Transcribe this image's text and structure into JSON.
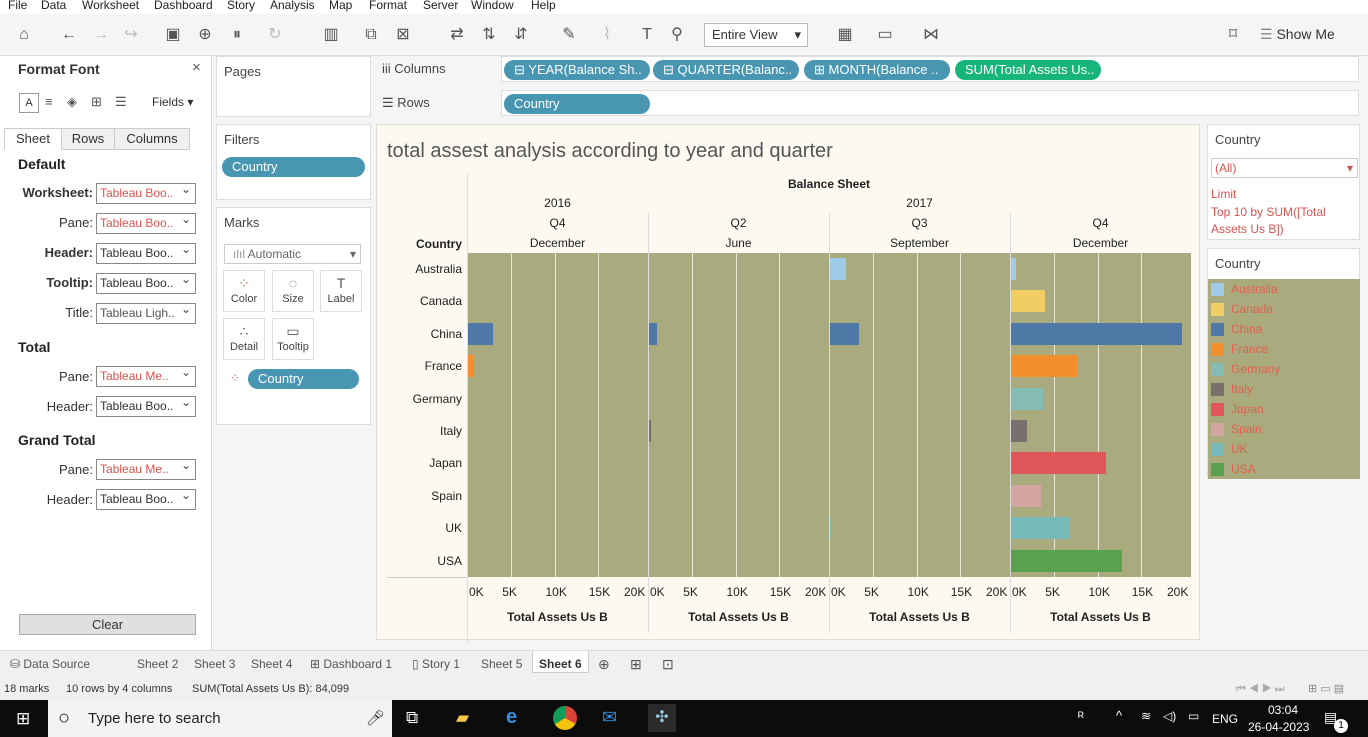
{
  "menu": [
    "File",
    "Data",
    "Worksheet",
    "Dashboard",
    "Story",
    "Analysis",
    "Map",
    "Format",
    "Server",
    "Window",
    "Help"
  ],
  "toolbar": {
    "view_select": "Entire View",
    "show_me": "Show Me"
  },
  "format_panel": {
    "title": "Format Font",
    "fields_label": "Fields",
    "tabs": [
      "Sheet",
      "Rows",
      "Columns"
    ],
    "sections": {
      "default": {
        "title": "Default",
        "worksheet_label": "Worksheet:",
        "worksheet_value": "Tableau Boo..",
        "pane_label": "Pane:",
        "pane_value": "Tableau Boo..",
        "header_label": "Header:",
        "header_value": "Tableau Boo..",
        "tooltip_label": "Tooltip:",
        "tooltip_value": "Tableau Boo..",
        "title_label": "Title:",
        "title_value": "Tableau Ligh.."
      },
      "total": {
        "title": "Total",
        "pane_label": "Pane:",
        "pane_value": "Tableau Me..",
        "header_label": "Header:",
        "header_value": "Tableau Boo.."
      },
      "grand_total": {
        "title": "Grand Total",
        "pane_label": "Pane:",
        "pane_value": "Tableau Me..",
        "header_label": "Header:",
        "header_value": "Tableau Boo.."
      }
    },
    "clear_label": "Clear"
  },
  "pages": {
    "title": "Pages"
  },
  "filters": {
    "title": "Filters",
    "pill": "Country"
  },
  "marks": {
    "title": "Marks",
    "type": "Automatic",
    "buttons": [
      "Color",
      "Size",
      "Label",
      "Detail",
      "Tooltip"
    ],
    "pill": "Country"
  },
  "shelves": {
    "columns_label": "Columns",
    "rows_label": "Rows",
    "columns": [
      "YEAR(Balance Sh..",
      "QUARTER(Balanc..",
      "MONTH(Balance ..",
      "SUM(Total Assets Us.."
    ],
    "rows": [
      "Country"
    ]
  },
  "view": {
    "title": "total assest analysis according to year and quarter",
    "header_top": "Balance Sheet",
    "row_header": "Country",
    "years": [
      "2016",
      "2017"
    ],
    "panes": [
      {
        "quarter": "Q4",
        "month": "December"
      },
      {
        "quarter": "Q2",
        "month": "June"
      },
      {
        "quarter": "Q3",
        "month": "September"
      },
      {
        "quarter": "Q4",
        "month": "December"
      }
    ],
    "ticks": [
      "0K",
      "5K",
      "10K",
      "15K",
      "20K"
    ],
    "axis_title": "Total Assets Us B"
  },
  "chart_data": {
    "type": "bar",
    "title": "total assest analysis according to year and quarter",
    "categories": [
      "Australia",
      "Canada",
      "China",
      "France",
      "Germany",
      "Italy",
      "Japan",
      "Spain",
      "UK",
      "USA"
    ],
    "xlabel": "Total Assets Us B",
    "xlim": [
      0,
      20000
    ],
    "colors": {
      "Australia": "#a0cbe8",
      "Canada": "#f1ce63",
      "China": "#4e79a7",
      "France": "#f28e2b",
      "Germany": "#86bcb6",
      "Italy": "#79706e",
      "Japan": "#e15759",
      "Spain": "#d4a6a0",
      "UK": "#78b9b9",
      "USA": "#59a14f"
    },
    "series": [
      {
        "name": "2016 Q4 December",
        "values": [
          0,
          0,
          2900,
          700,
          0,
          0,
          0,
          0,
          0,
          0
        ]
      },
      {
        "name": "2017 Q2 June",
        "values": [
          0,
          0,
          900,
          0,
          100,
          200,
          0,
          0,
          0,
          0
        ]
      },
      {
        "name": "2017 Q3 September",
        "values": [
          1800,
          0,
          3300,
          0,
          0,
          0,
          0,
          0,
          250,
          0
        ]
      },
      {
        "name": "2017 Q4 December",
        "values": [
          600,
          3900,
          19800,
          7600,
          3700,
          1800,
          11000,
          3500,
          6700,
          12800
        ]
      }
    ]
  },
  "country_filter": {
    "title": "Country",
    "value": "(All)",
    "limit_title": "Limit",
    "limit_text": "Top 10 by SUM([Total Assets Us B])"
  },
  "legend": {
    "title": "Country",
    "items": [
      "Australia",
      "Canada",
      "China",
      "France",
      "Germany",
      "Italy",
      "Japan",
      "Spain",
      "UK",
      "USA"
    ]
  },
  "sheet_tabs": [
    "Data Source",
    "Sheet 2",
    "Sheet 3",
    "Sheet 4",
    "Dashboard 1",
    "Story 1",
    "Sheet 5",
    "Sheet 6"
  ],
  "status": {
    "marks": "18 marks",
    "dims": "10 rows by 4 columns",
    "sum": "SUM(Total Assets Us B): 84,099"
  },
  "taskbar": {
    "search_placeholder": "Type here to search",
    "lang": "ENG",
    "time": "03:04",
    "date": "26-04-2023",
    "notif_count": "1"
  }
}
